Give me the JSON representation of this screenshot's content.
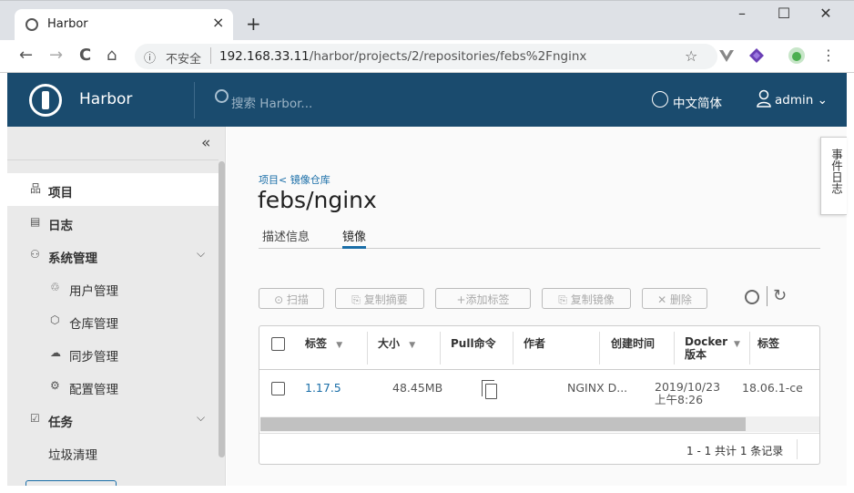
{
  "browser": {
    "tab_title": "Harbor",
    "tab_close": "×",
    "new_tab": "+",
    "window_controls": {
      "minimize": "–",
      "maximize": "☐",
      "close": "✕"
    },
    "nav": {
      "back": "←",
      "forward": "→",
      "reload": "C",
      "home": "⌂"
    },
    "security_icon": "ⓘ",
    "security_label": "不安全",
    "url_host": "192.168.33.11",
    "url_path": "/harbor/projects/2/repositories/febs%2Fnginx",
    "bookmark_icon": "☆",
    "menu_icon": "⋮"
  },
  "header": {
    "brand": "Harbor",
    "search_placeholder": "搜索 Harbor...",
    "language": "中文简体",
    "user": "admin",
    "user_chevron": "⌄",
    "color": "#1a4b6e"
  },
  "sidebar": {
    "collapse": "«",
    "items": [
      {
        "label": "项目",
        "icon": "品"
      },
      {
        "label": "日志",
        "icon": "▤"
      },
      {
        "label": "系统管理",
        "icon": "⚇",
        "chevron": "⌵"
      },
      {
        "label": "用户管理",
        "icon": "♲"
      },
      {
        "label": "仓库管理",
        "icon": "⬡"
      },
      {
        "label": "同步管理",
        "icon": "☁"
      },
      {
        "label": "配置管理",
        "icon": "⚙"
      },
      {
        "label": "任务",
        "icon": "☑",
        "chevron": "⌵"
      },
      {
        "label": "垃圾清理"
      }
    ]
  },
  "main": {
    "breadcrumb": "项目< 镜像仓库",
    "title": "febs/nginx",
    "tabs": [
      "描述信息",
      "镜像"
    ],
    "toolbar": {
      "scan": "⊙ 扫描",
      "copy_digest": "⎘ 复制摘要",
      "add_label": "+添加标签",
      "copy_image": "⎘ 复制镜像",
      "delete": "✕ 删除",
      "refresh": "↻"
    },
    "table": {
      "headers": [
        "标签",
        "大小",
        "Pull命令",
        "作者",
        "创建时间",
        "Docker 版本",
        "标签"
      ],
      "filter_icon": "▼",
      "rows": [
        {
          "tag": "1.17.5",
          "size": "48.45MB",
          "author": "NGINX D...",
          "created_date": "2019/10/23",
          "created_time": "上午8:26",
          "docker": "18.06.1-ce"
        }
      ],
      "footer": "1 - 1 共计 1 条记录"
    }
  },
  "event_log": "事件日志"
}
